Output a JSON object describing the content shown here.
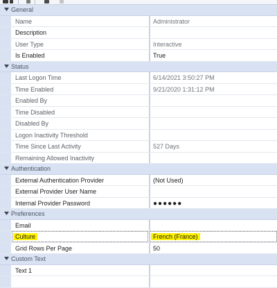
{
  "toolbar": {
    "icons": [
      "sort-icon",
      "categorize-icon",
      "properties-icon",
      "events-icon"
    ]
  },
  "categories": [
    {
      "name": "General",
      "rows": [
        {
          "name": "Name",
          "value": "Administrator",
          "muted": true
        },
        {
          "name": "Description",
          "value": "",
          "muted": false
        },
        {
          "name": "User Type",
          "value": "Interactive",
          "muted": true
        },
        {
          "name": "Is Enabled",
          "value": "True",
          "muted": false
        }
      ]
    },
    {
      "name": "Status",
      "rows": [
        {
          "name": "Last Logon Time",
          "value": "6/14/2021 3:50:27 PM",
          "muted": true
        },
        {
          "name": "Time Enabled",
          "value": "9/21/2020 1:31:12 PM",
          "muted": true
        },
        {
          "name": "Enabled By",
          "value": "",
          "muted": true
        },
        {
          "name": "Time Disabled",
          "value": "",
          "muted": true
        },
        {
          "name": "Disabled By",
          "value": "",
          "muted": true
        },
        {
          "name": "Logon Inactivity Threshold",
          "value": "",
          "muted": true
        },
        {
          "name": "Time Since Last Activity",
          "value": "527 Days",
          "muted": true
        },
        {
          "name": "Remaining Allowed Inactivity",
          "value": "",
          "muted": true
        }
      ]
    },
    {
      "name": "Authentication",
      "rows": [
        {
          "name": "External Authentication Provider",
          "value": "(Not Used)",
          "muted": false
        },
        {
          "name": "External Provider User Name",
          "value": "",
          "muted": false
        },
        {
          "name": "Internal Provider Password",
          "value": "●●●●●●",
          "muted": false,
          "password": true
        }
      ]
    },
    {
      "name": "Preferences",
      "rows": [
        {
          "name": "Email",
          "value": "",
          "muted": false
        },
        {
          "name": "Culture",
          "value": "French (France)",
          "muted": false,
          "highlighted": true,
          "selected": true
        },
        {
          "name": "Grid Rows Per Page",
          "value": "50",
          "muted": false
        }
      ]
    },
    {
      "name": "Custom Text",
      "rows": [
        {
          "name": "Text 1",
          "value": "",
          "muted": false
        },
        {
          "name": "",
          "value": "",
          "muted": false
        }
      ]
    }
  ],
  "colors": {
    "category_bg": "#d9e2f2",
    "highlight": "#fff200",
    "splitter": "#c6d1e4"
  }
}
